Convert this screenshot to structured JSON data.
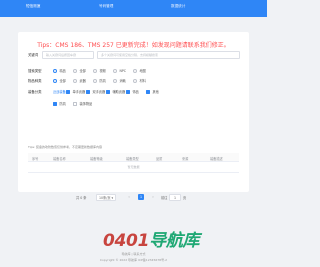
{
  "nav": {
    "tabs": [
      {
        "label": "短信测速"
      },
      {
        "label": "号码管理"
      },
      {
        "label": "数据统计"
      }
    ]
  },
  "notice": "Tips：CMS 186、TMS 257 已更新完成！如发现问题请联系我们修正。",
  "form": {
    "keyword_label": "关键词",
    "keyword_placeholder": "输入关键词后按回车键",
    "keyword_hint": "多个关键词可使用空格分隔，支持模糊搜索",
    "type_label": "搜索类型",
    "type_options": [
      "精品",
      "全部",
      "视频",
      "NPC",
      "地图"
    ],
    "sort_label": "物品种类",
    "sort_options": [
      "全部",
      "武器",
      "防具",
      "消耗",
      "材料"
    ],
    "category_label": "装备分类",
    "category_groups": [
      {
        "name": "近战装备",
        "options": [
          "单手武器",
          "双手武器",
          "辅助武器",
          "饰品",
          "其他"
        ]
      },
      {
        "name": "",
        "options": [
          "防具",
          "装饰物品"
        ]
      }
    ]
  },
  "tip": "Tips: 装备的攻防数值仅供参考，不定期更新数据库内容",
  "table": {
    "columns": [
      "序号",
      "装备名称",
      "装备等级",
      "装备类型",
      "品质",
      "来源",
      "装备描述"
    ],
    "empty_text": "暂无数据"
  },
  "pager": {
    "total": "共 0 条",
    "page_size": "10条/页",
    "current_page": "1",
    "goto_label": "前往",
    "goto_value": "1",
    "page_suffix": "页"
  },
  "brand": {
    "logo_part1": "0401",
    "logo_part2": "导航库"
  },
  "footer": {
    "line1": "导航库 | 联系方式",
    "line2": "Copyright © 2022 导航库 ICP备12345678号-2"
  },
  "colors": {
    "accent": "#2f86f6",
    "notice": "#ff4d4f",
    "logo_red": "#c8453f",
    "logo_green": "#1fa874"
  }
}
